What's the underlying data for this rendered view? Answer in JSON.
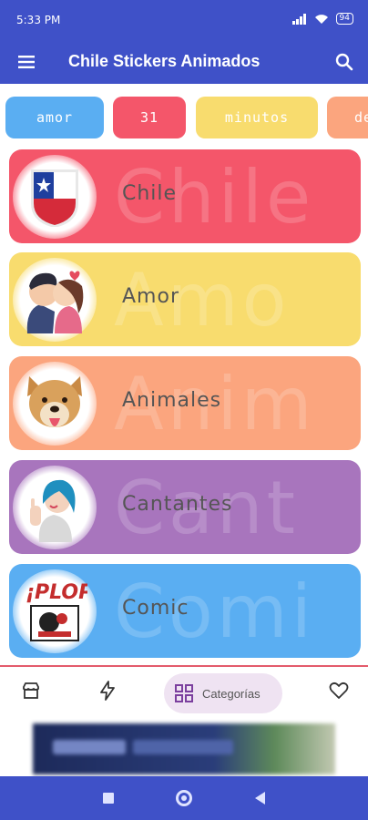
{
  "status_bar": {
    "time": "5:33 PM",
    "battery": "94"
  },
  "app_bar": {
    "title": "Chile Stickers Animados"
  },
  "chips": [
    {
      "label": "amor",
      "color": "#5aaef2"
    },
    {
      "label": "31",
      "color": "#f4566a"
    },
    {
      "label": "minutos",
      "color": "#f8dc6e"
    },
    {
      "label": "de",
      "color": "#fba57e"
    }
  ],
  "categories": [
    {
      "label": "Chile",
      "bg_word": "Chile",
      "color": "#f4566a",
      "icon": "chile-flag-icon"
    },
    {
      "label": "Amor",
      "bg_word": "Amo",
      "color": "#f8dc6e",
      "icon": "kissing-couple-icon"
    },
    {
      "label": "Animales",
      "bg_word": "Anim",
      "color": "#fba57e",
      "icon": "dog-icon"
    },
    {
      "label": "Cantantes",
      "bg_word": "Cant",
      "color": "#a875bd",
      "icon": "singer-icon"
    },
    {
      "label": "Comic",
      "bg_word": "Comi",
      "color": "#5aaef2",
      "icon": "comic-plop-icon"
    }
  ],
  "bottom_nav": {
    "active_label": "Categorías",
    "items": [
      "store-icon",
      "lightning-icon",
      "grid-icon",
      "heart-icon"
    ]
  },
  "ad_banner": {
    "label": ""
  }
}
